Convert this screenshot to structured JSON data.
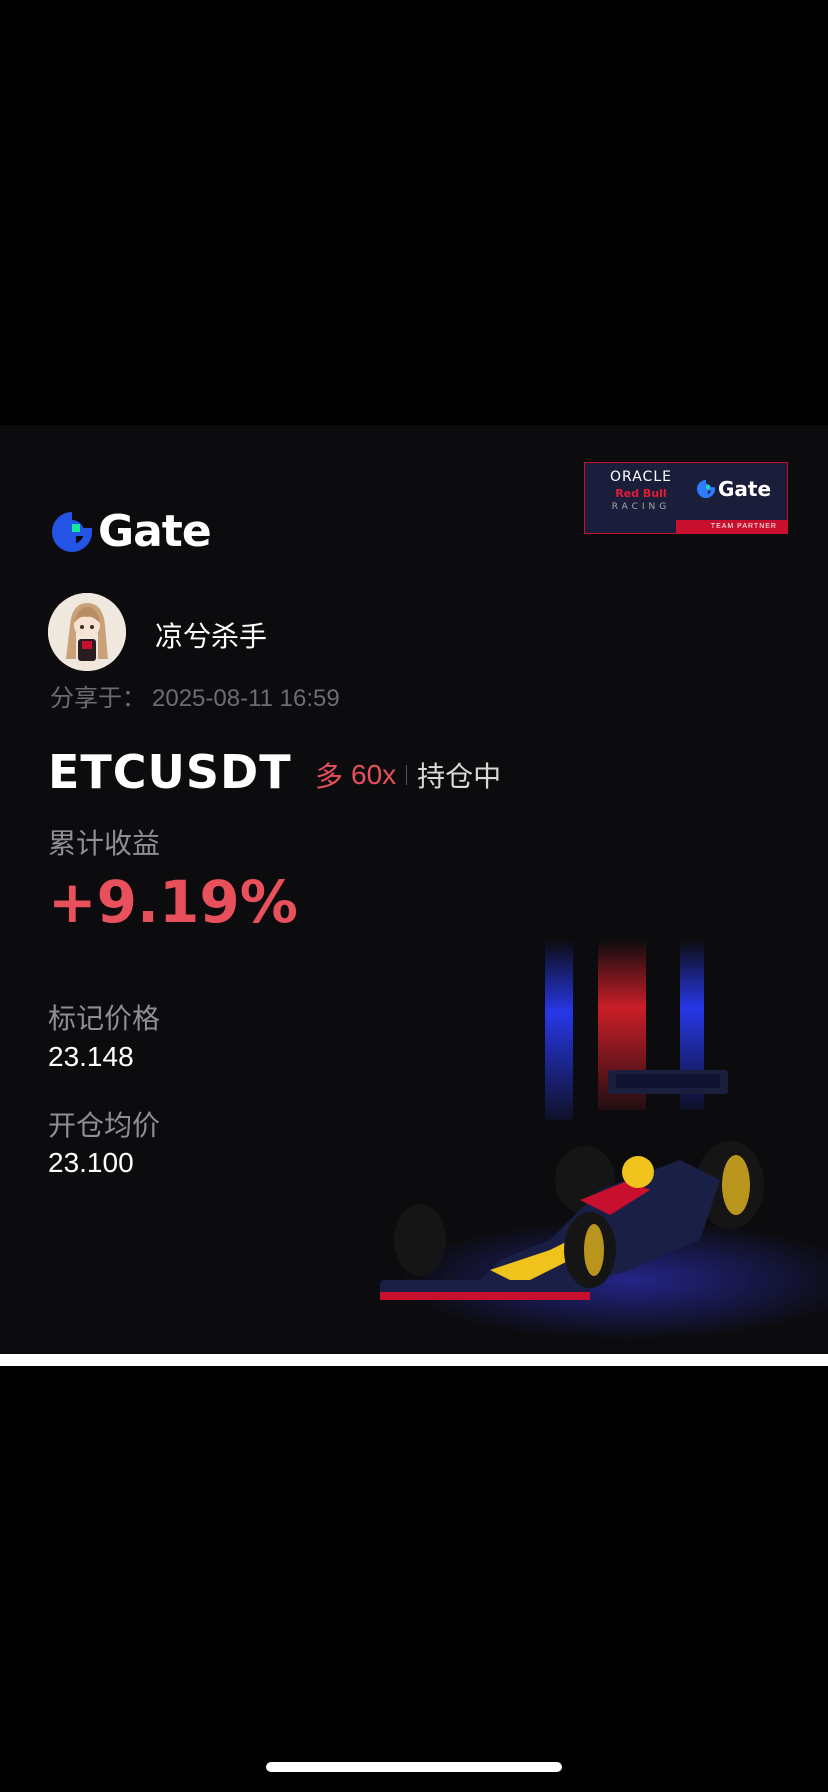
{
  "brand": {
    "logo_text": "Gate",
    "partner": {
      "oracle": "ORACLE",
      "redbull": "Red Bull",
      "racing": "RACING",
      "gate": "Gate",
      "team_partner": "TEAM PARTNER"
    }
  },
  "user": {
    "name": "凉兮杀手",
    "shared_label": "分享于：",
    "shared_time": "2025-08-11 16:59"
  },
  "position": {
    "pair": "ETCUSDT",
    "direction": "多",
    "leverage": "60x",
    "status": "持仓中"
  },
  "stats": {
    "pnl_label": "累计收益",
    "pnl_value": "+9.19%",
    "mark_price_label": "标记价格",
    "mark_price_value": "23.148",
    "entry_price_label": "开仓均价",
    "entry_price_value": "23.100"
  },
  "colors": {
    "accent_red": "#e8505b",
    "gate_blue": "#2354e6",
    "gate_green": "#17e6a1"
  }
}
